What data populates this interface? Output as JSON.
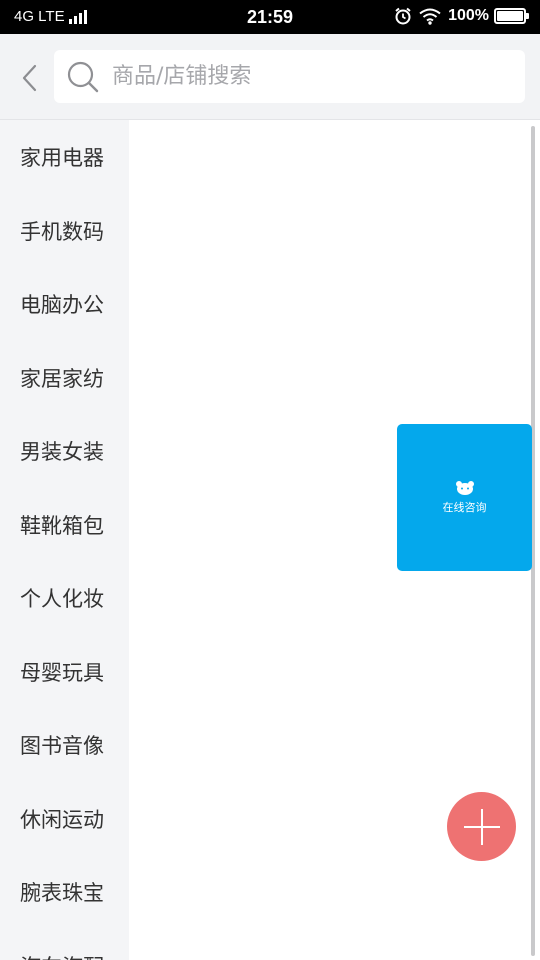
{
  "status_bar": {
    "network": "4G LTE",
    "time": "21:59",
    "battery": "100%"
  },
  "header": {
    "search_placeholder": "商品/店铺搜索"
  },
  "categories": [
    {
      "label": "家用电器"
    },
    {
      "label": "手机数码"
    },
    {
      "label": "电脑办公"
    },
    {
      "label": "家居家纺"
    },
    {
      "label": "男装女装"
    },
    {
      "label": "鞋靴箱包"
    },
    {
      "label": "个人化妆"
    },
    {
      "label": "母婴玩具"
    },
    {
      "label": "图书音像"
    },
    {
      "label": "休闲运动"
    },
    {
      "label": "腕表珠宝"
    },
    {
      "label": "汽车汽配"
    }
  ],
  "consult": {
    "label": "在线咨询"
  },
  "colors": {
    "accent_blue": "#04a8ec",
    "fab_red": "#ee7272",
    "sidebar_bg": "#f4f5f7"
  },
  "icons": {
    "back": "chevron-left-icon",
    "search": "search-icon",
    "consult": "chat-bear-icon",
    "fab": "plus-icon",
    "alarm": "alarm-icon",
    "wifi": "wifi-icon",
    "battery": "battery-icon",
    "signal": "signal-icon"
  }
}
